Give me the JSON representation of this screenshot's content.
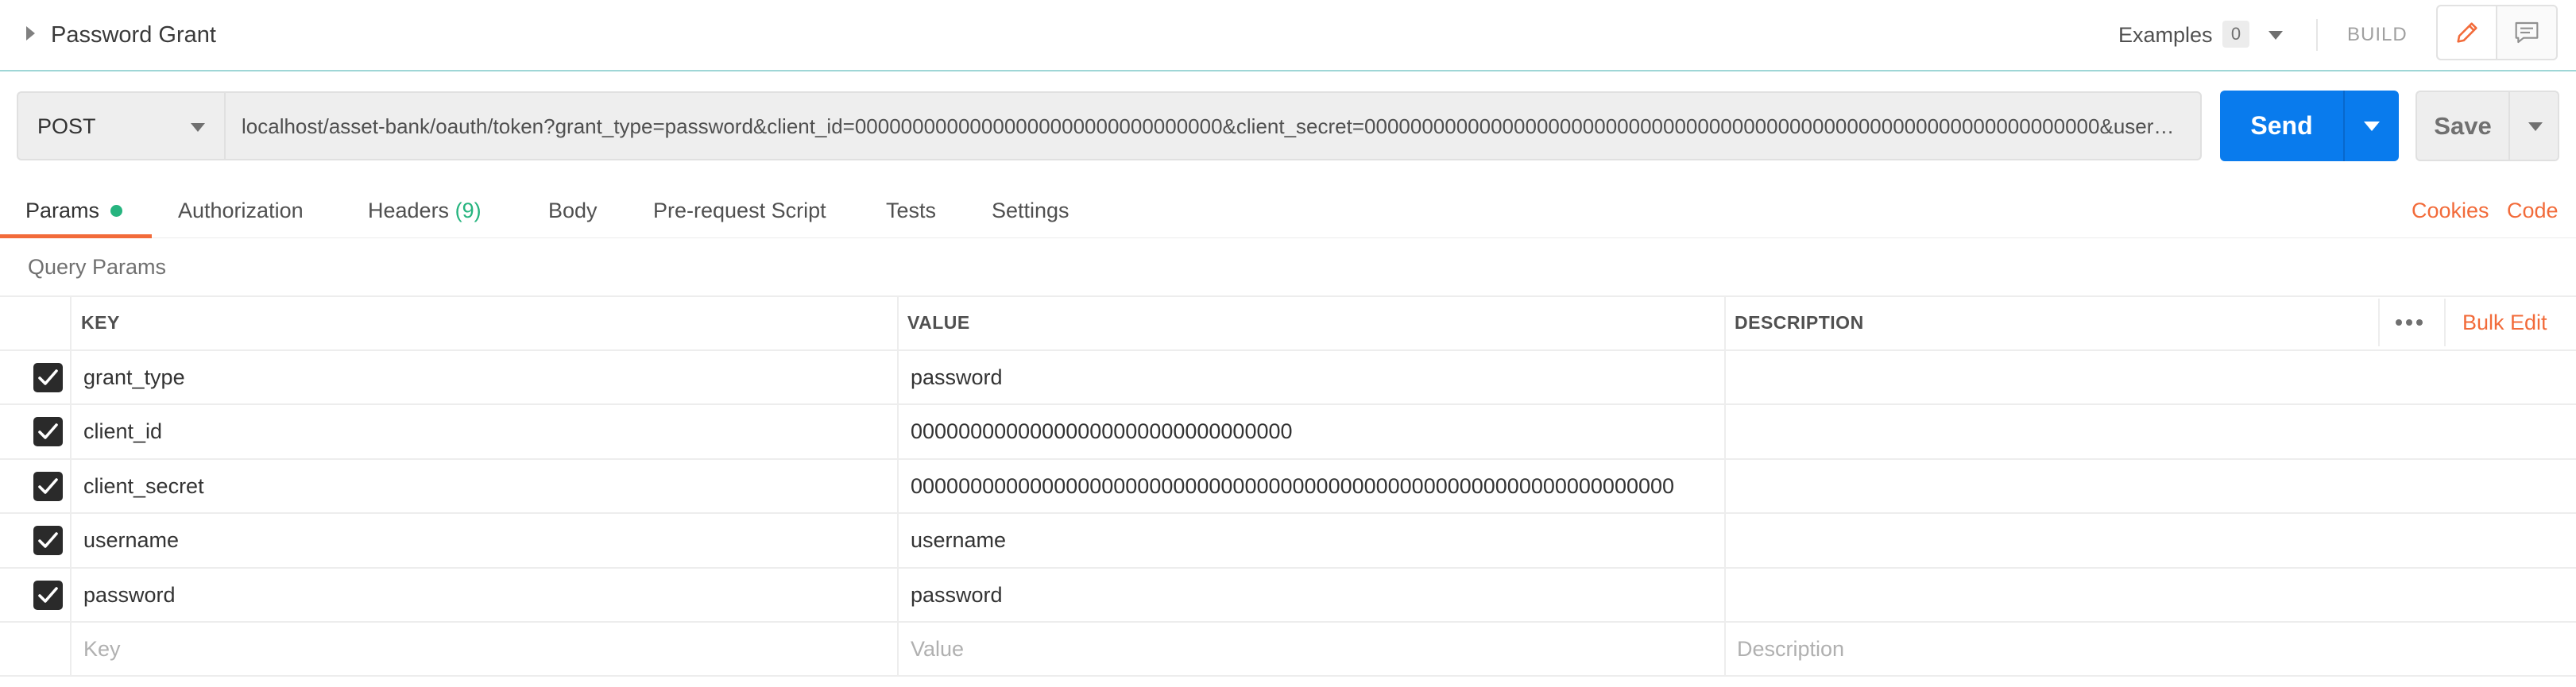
{
  "header": {
    "title": "Password Grant",
    "examples_label": "Examples",
    "examples_count": "0",
    "build_label": "BUILD",
    "icons": [
      "caret-right-icon",
      "pencil-icon",
      "comment-icon",
      "chevron-down-icon"
    ]
  },
  "request": {
    "method": "POST",
    "url": "localhost/asset-bank/oauth/token?grant_type=password&client_id=00000000000000000000000000000000&client_secret=0000000000000000000000000000000000000000000000000000000000000000&username=username&password=password",
    "send_label": "Send",
    "save_label": "Save"
  },
  "tabs": {
    "params": "Params",
    "authorization": "Authorization",
    "headers": "Headers",
    "headers_count": "(9)",
    "body": "Body",
    "pre_request": "Pre-request Script",
    "tests": "Tests",
    "settings": "Settings",
    "cookies": "Cookies",
    "code": "Code"
  },
  "query_params": {
    "title": "Query Params",
    "columns": {
      "key": "KEY",
      "value": "VALUE",
      "description": "DESCRIPTION"
    },
    "bulk_edit": "Bulk Edit",
    "rows": [
      {
        "key": "grant_type",
        "value": "password",
        "description": "",
        "checked": true
      },
      {
        "key": "client_id",
        "value": "00000000000000000000000000000000",
        "description": "",
        "checked": true
      },
      {
        "key": "client_secret",
        "value": "0000000000000000000000000000000000000000000000000000000000000000",
        "description": "",
        "checked": true
      },
      {
        "key": "username",
        "value": "username",
        "description": "",
        "checked": true
      },
      {
        "key": "password",
        "value": "password",
        "description": "",
        "checked": true
      }
    ],
    "new_row": {
      "key_placeholder": "Key",
      "value_placeholder": "Value",
      "description_placeholder": "Description"
    }
  },
  "colors": {
    "accent": "#f26b3a",
    "primary": "#097bed",
    "success": "#26b47f"
  }
}
